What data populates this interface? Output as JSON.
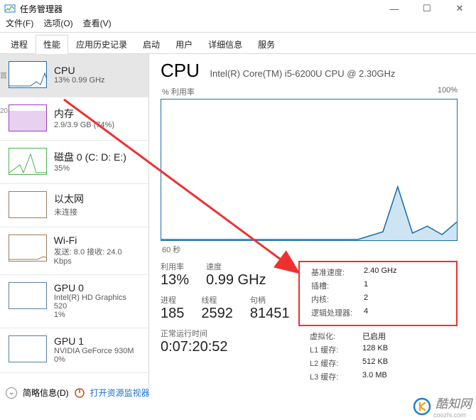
{
  "window": {
    "title": "任务管理器",
    "min": "—",
    "max": "☐",
    "close": "✕"
  },
  "menu": {
    "file": "文件(F)",
    "options": "选项(O)",
    "view": "查看(V)"
  },
  "tabs": [
    "进程",
    "性能",
    "应用历史记录",
    "启动",
    "用户",
    "详细信息",
    "服务"
  ],
  "sidebar": [
    {
      "name": "CPU",
      "sub": "13% 0.99 GHz"
    },
    {
      "name": "内存",
      "sub": "2.9/3.9 GB (74%)"
    },
    {
      "name": "磁盘 0 (C: D: E:)",
      "sub": "35%"
    },
    {
      "name": "以太网",
      "sub": "未连接"
    },
    {
      "name": "Wi-Fi",
      "sub": "发送: 8.0 接收: 24.0 Kbps"
    },
    {
      "name": "GPU 0",
      "sub": "Intel(R) HD Graphics 520",
      "sub2": "1%"
    },
    {
      "name": "GPU 1",
      "sub": "NVIDIA GeForce 930M",
      "sub2": "0%"
    }
  ],
  "detail": {
    "heading": "CPU",
    "model": "Intel(R) Core(TM) i5-6200U CPU @ 2.30GHz",
    "graph_label": "% 利用率",
    "graph_max": "100%",
    "graph_duration": "60 秒",
    "stats": {
      "util_label": "利用率",
      "util": "13%",
      "speed_label": "速度",
      "speed": "0.99 GHz",
      "proc_label": "进程",
      "proc": "185",
      "thread_label": "线程",
      "thread": "2592",
      "handle_label": "句柄",
      "handle": "81451",
      "uptime_label": "正常运行时间",
      "uptime": "0:07:20:52"
    },
    "right": {
      "base_label": "基准速度:",
      "base": "2.40 GHz",
      "sockets_label": "插槽:",
      "sockets": "1",
      "cores_label": "内核:",
      "cores": "2",
      "lp_label": "逻辑处理器:",
      "lp": "4",
      "virt_label": "虚拟化:",
      "virt": "已启用",
      "l1_label": "L1 缓存:",
      "l1": "128 KB",
      "l2_label": "L2 缓存:",
      "l2": "512 KB",
      "l3_label": "L3 缓存:",
      "l3": "3.0 MB"
    }
  },
  "footer": {
    "fewer": "简略信息(D)",
    "resmon": "打开资源监视器"
  },
  "watermark": {
    "brand": "酷知网",
    "url": "coozhi.com"
  },
  "chart_data": {
    "type": "line",
    "title": "% 利用率",
    "xlabel": "60 秒",
    "ylabel": "",
    "ylim": [
      0,
      100
    ],
    "x_seconds": [
      60,
      55,
      50,
      45,
      40,
      35,
      30,
      25,
      20,
      15,
      10,
      5,
      0
    ],
    "values": [
      0,
      0,
      0,
      0,
      0,
      0,
      0,
      0,
      0,
      6,
      38,
      5,
      13
    ]
  }
}
